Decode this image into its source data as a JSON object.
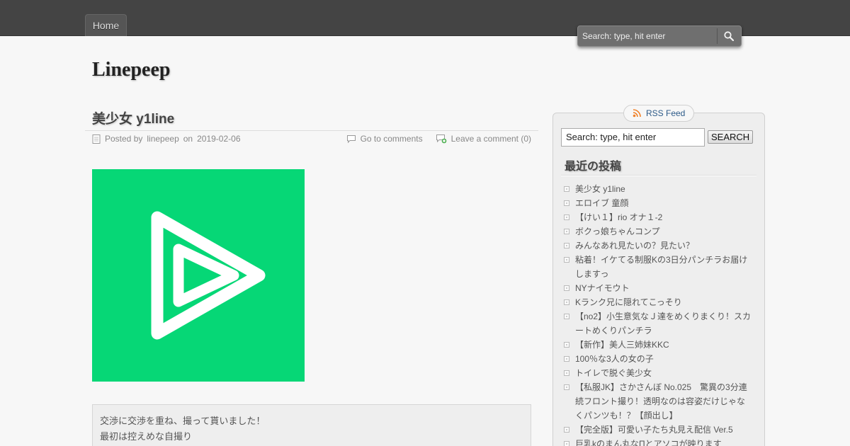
{
  "nav": {
    "home_label": "Home"
  },
  "top_search": {
    "placeholder": "Search: type, hit enter"
  },
  "site": {
    "title": "Linepeep"
  },
  "post": {
    "title": "美少女 y1line",
    "posted_by_prefix": "Posted by",
    "author": "linepeep",
    "on_word": "on",
    "date": "2019-02-06",
    "go_to_comments": "Go to comments",
    "leave_comment": "Leave a comment (0)",
    "excerpt_lines": [
      "交渉に交渉を重ね、撮って貰いました！",
      "最初は控えめな自撮り"
    ]
  },
  "sidebar": {
    "rss_label": "RSS Feed",
    "search_value": "Search: type, hit enter",
    "search_button": "SEARCH",
    "recent_title": "最近の投稿",
    "recent_posts": [
      [
        "美少女 y1line"
      ],
      [
        "エロイブ 童顔"
      ],
      [
        "【けい１】rio オナ１-2"
      ],
      [
        "ボクっ娘ちゃんコンプ"
      ],
      [
        "みんなあれ見たいの？見たい？"
      ],
      [
        "粘着！イケてる制服Kの3日分パンチラお届け",
        "しますっ"
      ],
      [
        "NYナイモウト"
      ],
      [
        "Kランク兄に隠れてこっそり"
      ],
      [
        "【no2】小生意気なＪ達をめくりまくり！スカ",
        "ートめくりパンチラ"
      ],
      [
        "【新作】美人三姉妹KKC"
      ],
      [
        "100％な3人の女の子"
      ],
      [
        "トイレで脱ぐ美少女"
      ],
      [
        "【私服JK】さかさんぼ No.025　驚異の3分連",
        "続フロント撮り！透明なのは容姿だけじゃな",
        "くパンツも！？【顔出し】"
      ],
      [
        "【完全版】可愛い子たち丸見え配信 Ver.5"
      ],
      [
        "巨乳kのまん丸なΠとアソコが映ります"
      ]
    ]
  },
  "colors": {
    "topbar": "#444444",
    "image_green": "#06d776",
    "rss_link": "#2c5a88",
    "rss_icon": "#f0822a"
  }
}
